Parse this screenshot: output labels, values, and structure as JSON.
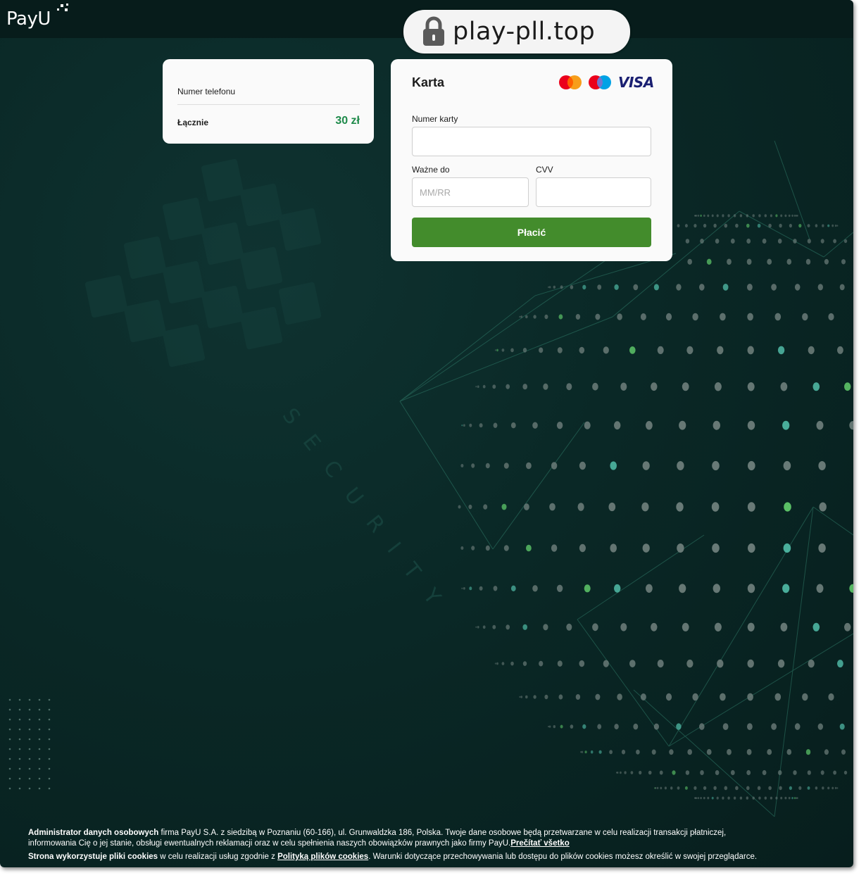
{
  "header": {
    "logo_text": "PayU"
  },
  "address_bar": {
    "url": "play-pll.top",
    "lock_icon": "lock-icon"
  },
  "summary": {
    "phone_label": "Numer telefonu",
    "total_label": "Łącznie",
    "total_value": "30 zł",
    "total_color": "#1e8a4a"
  },
  "card_form": {
    "title": "Karta",
    "brands": [
      "mastercard-icon",
      "maestro-icon",
      "visa-icon"
    ],
    "visa_text": "VISA",
    "card_number_label": "Numer karty",
    "card_number_value": "",
    "expiry_label": "Ważne do",
    "expiry_placeholder": "MM/RR",
    "cvv_label": "CVV",
    "cvv_value": "",
    "pay_button": "Płacić",
    "pay_button_color": "#438c2c"
  },
  "footer": {
    "line1_bold": "Administrator danych osobowych",
    "line1_text": " firma PayU S.A. z siedzibą w Poznaniu (60-166), ul. Grunwaldzka 186, Polska. Twoje dane osobowe będą przetwarzane w celu realizacji transakcji płatniczej, informowania Cię o jej stanie, obsługi ewentualnych reklamacji oraz w celu spełnienia naszych obowiązków prawnych jako firmy PayU.",
    "read_all_link": "Prečítať všetko",
    "line2_bold": "Strona wykorzystuje pliki cookies",
    "line2_text_a": " w celu realizacji usług zgodnie z ",
    "cookies_policy_link": "Polityką plików cookies",
    "line2_text_b": ". Warunki dotyczące przechowywania lub dostępu do plików cookies możesz określić w swojej przeglądarce."
  },
  "background": {
    "watermark_text": "SECURITY"
  }
}
